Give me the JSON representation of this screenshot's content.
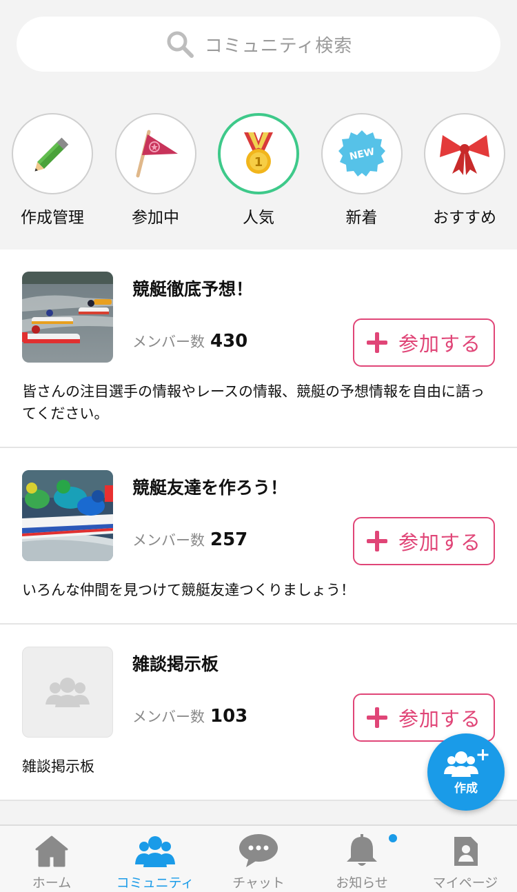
{
  "search": {
    "placeholder": "コミュニティ検索",
    "icon": "search-icon"
  },
  "categories": [
    {
      "label": "作成管理",
      "icon": "pencil-icon"
    },
    {
      "label": "参加中",
      "icon": "flag-icon"
    },
    {
      "label": "人気",
      "icon": "medal-icon",
      "active": true
    },
    {
      "label": "新着",
      "icon": "new-badge-icon",
      "badge_text": "NEW"
    },
    {
      "label": "おすすめ",
      "icon": "ribbon-icon"
    }
  ],
  "communities": [
    {
      "title": "競艇徹底予想！",
      "members_label": "メンバー数",
      "members": "430",
      "join_label": "参加する",
      "desc": "皆さんの注目選手の情報やレースの情報、競艇の予想情報を自由に語ってください。"
    },
    {
      "title": "競艇友達を作ろう！",
      "members_label": "メンバー数",
      "members": "257",
      "join_label": "参加する",
      "desc": "いろんな仲間を見つけて競艇友達つくりましょう！"
    },
    {
      "title": "雑談掲示板",
      "members_label": "メンバー数",
      "members": "103",
      "join_label": "参加する",
      "desc": "雑談掲示板"
    }
  ],
  "fab": {
    "label": "作成",
    "icon": "group-add-icon"
  },
  "nav": [
    {
      "label": "ホーム",
      "icon": "home-icon"
    },
    {
      "label": "コミュニティ",
      "icon": "community-icon",
      "active": true
    },
    {
      "label": "チャット",
      "icon": "chat-icon"
    },
    {
      "label": "お知らせ",
      "icon": "bell-icon",
      "has_dot": true
    },
    {
      "label": "マイページ",
      "icon": "profile-icon"
    }
  ],
  "colors": {
    "accent_blue": "#1a9be8",
    "join_pink": "#e04577",
    "active_green": "#3ec98a",
    "background": "#f3f3f3"
  }
}
